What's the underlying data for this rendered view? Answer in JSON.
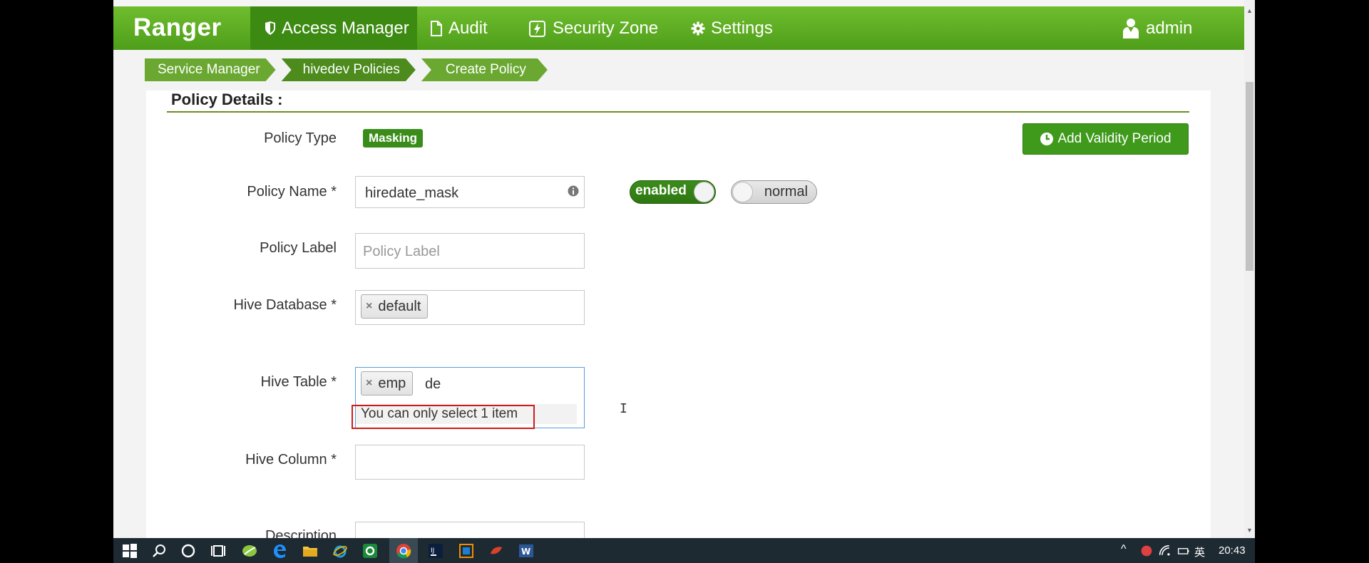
{
  "nav": {
    "brand": "Ranger",
    "items": [
      {
        "label": "Access Manager"
      },
      {
        "label": "Audit"
      },
      {
        "label": "Security Zone"
      },
      {
        "label": "Settings"
      }
    ],
    "user": "admin"
  },
  "breadcrumb": [
    "Service Manager",
    "hivedev Policies",
    "Create Policy"
  ],
  "form": {
    "section_title": "Policy Details :",
    "policy_type_label": "Policy Type",
    "policy_type_value": "Masking",
    "validity_button": "Add Validity Period",
    "policy_name_label": "Policy Name *",
    "policy_name_value": "hiredate_mask",
    "enabled_toggle": "enabled",
    "normal_toggle": "normal",
    "policy_label_label": "Policy Label",
    "policy_label_placeholder": "Policy Label",
    "hive_database_label": "Hive Database *",
    "hive_database_tag": "default",
    "hive_table_label": "Hive Table *",
    "hive_table_tag": "emp",
    "hive_table_typed": "de",
    "dropdown_message": "You can only select 1 item",
    "hive_column_label": "Hive Column *",
    "description_label": "Description"
  },
  "taskbar": {
    "time": "20:43",
    "ime": "英"
  },
  "colors": {
    "nav_green": "#5aa823",
    "active_nav": "#3d8a12",
    "button_green": "#3f9a1c",
    "highlight_red": "#d21a1a"
  }
}
